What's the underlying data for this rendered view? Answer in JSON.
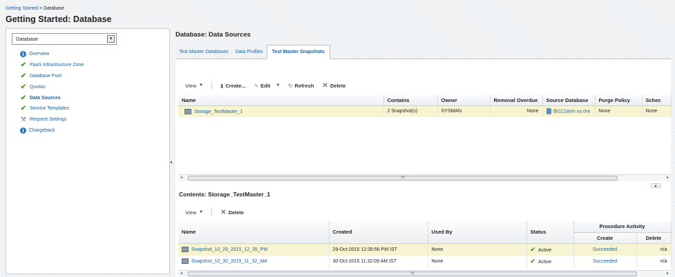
{
  "breadcrumb": {
    "parent": "Getting Started",
    "separator": " > ",
    "current": "Database"
  },
  "page_title": "Getting Started: Database",
  "sidebar": {
    "select_value": "Database",
    "items": [
      {
        "label": "Overview",
        "icon": "info-icon"
      },
      {
        "label": "PaaS Infrastructure Zone",
        "icon": "check-icon"
      },
      {
        "label": "Database Pool",
        "icon": "check-icon"
      },
      {
        "label": "Quotas",
        "icon": "check-icon"
      },
      {
        "label": "Data Sources",
        "icon": "check-icon",
        "active": true
      },
      {
        "label": "Service Templates",
        "icon": "check-icon"
      },
      {
        "label": "Request Settings",
        "icon": "tools-icon"
      },
      {
        "label": "Chargeback",
        "icon": "info-icon"
      }
    ]
  },
  "main": {
    "title": "Database: Data Sources",
    "tabs": [
      {
        "label": "Test Master Databases"
      },
      {
        "label": "Data Profiles"
      },
      {
        "label": "Test Master Snapshots",
        "active": true
      }
    ]
  },
  "toolbar1": {
    "view": "View",
    "create": "Create...",
    "edit": "Edit",
    "refresh": "Refresh",
    "delete": "Delete"
  },
  "snapshots_table": {
    "headers": [
      "Name",
      "Contains",
      "Owner",
      "Removal Overdue",
      "Source Database",
      "Purge Policy",
      "Schec"
    ],
    "rows": [
      {
        "name": "Storage_TestMaster_1",
        "contains": "2 Snapshot(s)",
        "owner": "SYSMAN",
        "removal_overdue": "None",
        "source_database": "db112asm.us.ora",
        "purge_policy": "None",
        "schedule": "None"
      }
    ],
    "scroll_label": "III"
  },
  "contents": {
    "title": "Contents: Storage_TestMaster_1",
    "toolbar": {
      "view": "View",
      "delete": "Delete"
    },
    "headers": {
      "name": "Name",
      "created": "Created",
      "used_by": "Used By",
      "status": "Status",
      "procedure_activity": "Procedure Activity",
      "create": "Create",
      "delete": "Delete"
    },
    "rows": [
      {
        "name": "Snapshot_10_29_2015_12_35_PM",
        "created": "29-Oct-2015 12:35:56 PM IST",
        "used_by": "None",
        "status": "Active",
        "create": "Succeeded",
        "delete": "n/a"
      },
      {
        "name": "Snapshot_10_30_2015_11_32_AM",
        "created": "30-Oct-2015 11:32:09 AM IST",
        "used_by": "None",
        "status": "Active",
        "create": "Succeeded",
        "delete": "n/a"
      }
    ],
    "scroll_label": "III"
  },
  "colors": {
    "link": "#1f5f9e",
    "success": "#4b9a2c",
    "selected_row": "#f7f4d2"
  }
}
